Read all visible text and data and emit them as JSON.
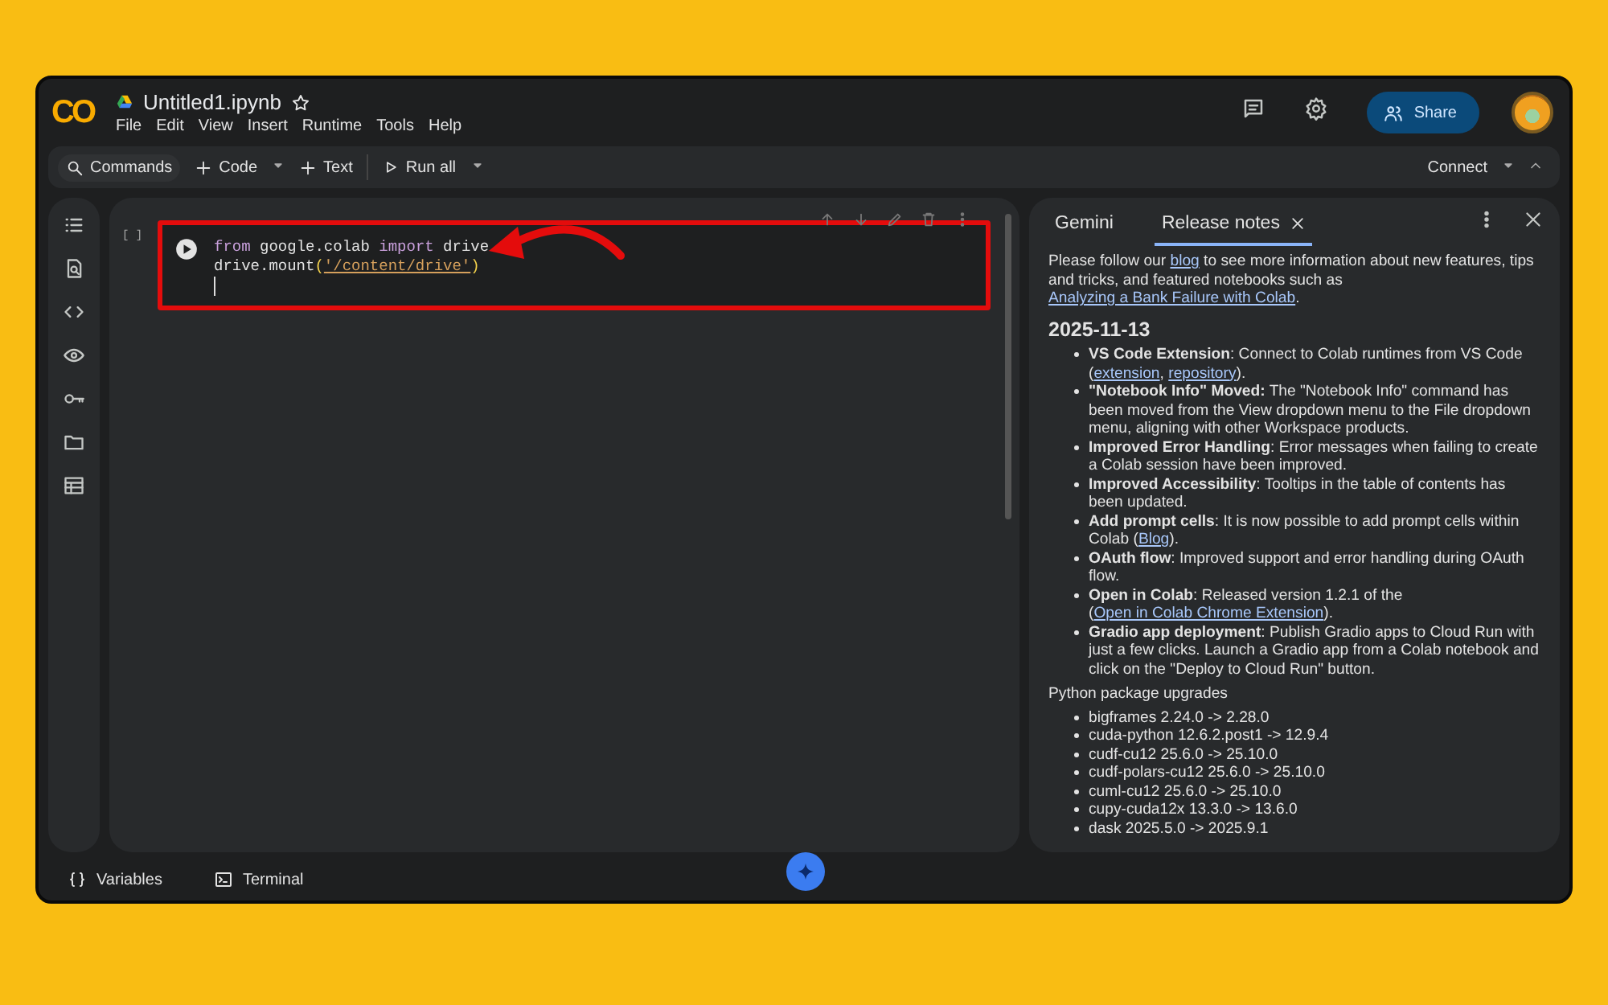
{
  "app": {
    "logo": "CO",
    "title": "Untitled1.ipynb"
  },
  "menu": [
    "File",
    "Edit",
    "View",
    "Insert",
    "Runtime",
    "Tools",
    "Help"
  ],
  "share": "Share",
  "toolbar": {
    "commands": "Commands",
    "add_code": "Code",
    "add_text": "Text",
    "run_all": "Run all",
    "connect": "Connect"
  },
  "cell": {
    "exec_count": "[ ]",
    "highlighted": true,
    "lines": [
      [
        {
          "text": "from",
          "kind": "keyword"
        },
        {
          "text": " google.colab ",
          "kind": "plain"
        },
        {
          "text": "import",
          "kind": "keyword"
        },
        {
          "text": " drive",
          "kind": "plain"
        }
      ],
      [
        {
          "text": "drive.mount",
          "kind": "plain"
        },
        {
          "text": "(",
          "kind": "paren"
        },
        {
          "text": "'/content/drive'",
          "kind": "string"
        },
        {
          "text": ")",
          "kind": "paren"
        }
      ]
    ]
  },
  "panel": {
    "tabs": [
      {
        "label": "Gemini",
        "selected": false,
        "closable": false
      },
      {
        "label": "Release notes",
        "selected": true,
        "closable": true
      }
    ],
    "intro": [
      {
        "text": "Please follow our ",
        "kind": "plain"
      },
      {
        "text": "blog",
        "kind": "link"
      },
      {
        "text": " to see more information about new features, tips and tricks, and featured notebooks such as ",
        "kind": "plain"
      },
      {
        "text": "Analyzing a Bank Failure with Colab",
        "kind": "link"
      },
      {
        "text": ".",
        "kind": "plain"
      }
    ],
    "date": "2025-11-13",
    "notes": [
      [
        {
          "text": "VS Code Extension",
          "kind": "bold"
        },
        {
          "text": ": Connect to Colab runtimes from VS Code (",
          "kind": "plain"
        },
        {
          "text": "extension",
          "kind": "link"
        },
        {
          "text": ", ",
          "kind": "plain"
        },
        {
          "text": "repository",
          "kind": "link"
        },
        {
          "text": ").",
          "kind": "plain"
        }
      ],
      [
        {
          "text": "\"Notebook Info\" Moved:",
          "kind": "bold"
        },
        {
          "text": " The \"Notebook Info\" command has been moved from the View dropdown menu to the File dropdown menu, aligning with other Workspace products.",
          "kind": "plain"
        }
      ],
      [
        {
          "text": "Improved Error Handling",
          "kind": "bold"
        },
        {
          "text": ": Error messages when failing to create a Colab session have been improved.",
          "kind": "plain"
        }
      ],
      [
        {
          "text": "Improved Accessibility",
          "kind": "bold"
        },
        {
          "text": ": Tooltips in the table of contents has been updated.",
          "kind": "plain"
        }
      ],
      [
        {
          "text": "Add prompt cells",
          "kind": "bold"
        },
        {
          "text": ": It is now possible to add prompt cells within Colab (",
          "kind": "plain"
        },
        {
          "text": "Blog",
          "kind": "link"
        },
        {
          "text": ").",
          "kind": "plain"
        }
      ],
      [
        {
          "text": "OAuth flow",
          "kind": "bold"
        },
        {
          "text": ": Improved support and error handling during OAuth flow.",
          "kind": "plain"
        }
      ],
      [
        {
          "text": "Open in Colab",
          "kind": "bold"
        },
        {
          "text": ": Released version 1.2.1 of the (",
          "kind": "plain"
        },
        {
          "text": "Open in Colab Chrome Extension",
          "kind": "link"
        },
        {
          "text": ").",
          "kind": "plain"
        }
      ],
      [
        {
          "text": "Gradio app deployment",
          "kind": "bold"
        },
        {
          "text": ": Publish Gradio apps to Cloud Run with just a few clicks. Launch a Gradio app from a Colab notebook and click on the \"Deploy to Cloud Run\" button.",
          "kind": "plain"
        }
      ]
    ],
    "packages_heading": "Python package upgrades",
    "packages": [
      "bigframes 2.24.0 -> 2.28.0",
      "cuda-python 12.6.2.post1 -> 12.9.4",
      "cudf-cu12 25.6.0 -> 25.10.0",
      "cudf-polars-cu12 25.6.0 -> 25.10.0",
      "cuml-cu12 25.6.0 -> 25.10.0",
      "cupy-cuda12x 13.3.0 -> 13.6.0",
      "dask 2025.5.0 -> 2025.9.1"
    ]
  },
  "bottom_bar": [
    {
      "label": "Variables",
      "kind": "variables"
    },
    {
      "label": "Terminal",
      "kind": "terminal"
    }
  ]
}
